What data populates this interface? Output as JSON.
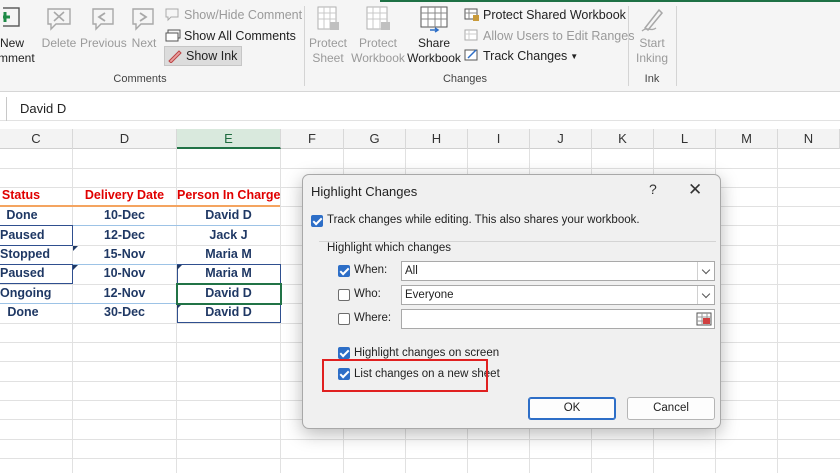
{
  "ribbon": {
    "comments": {
      "new_comment_line1": "New",
      "new_comment_line2": "mment",
      "delete": "Delete",
      "previous": "Previous",
      "next": "Next",
      "show_hide": "Show/Hide Comment",
      "show_all": "Show All Comments",
      "show_ink": "Show Ink",
      "group_label": "Comments"
    },
    "changes": {
      "protect_sheet_1": "Protect",
      "protect_sheet_2": "Sheet",
      "protect_workbook_1": "Protect",
      "protect_workbook_2": "Workbook",
      "share_workbook_1": "Share",
      "share_workbook_2": "Workbook",
      "protect_shared": "Protect Shared Workbook",
      "allow_users": "Allow Users to Edit Ranges",
      "track_changes": "Track Changes",
      "group_label": "Changes"
    },
    "ink": {
      "start_inking_1": "Start",
      "start_inking_2": "Inking",
      "group_label": "Ink"
    }
  },
  "formula_bar": {
    "value": "David D"
  },
  "grid": {
    "columns": [
      "C",
      "D",
      "E",
      "F",
      "G",
      "H",
      "I",
      "J",
      "K",
      "L",
      "M",
      "N"
    ],
    "headers": [
      "Status",
      "Delivery Date",
      "Person In Charge"
    ],
    "rows": [
      [
        "Done",
        "10-Dec",
        "David D"
      ],
      [
        "Paused",
        "12-Dec",
        "Jack J"
      ],
      [
        "Stopped",
        "15-Nov",
        "Maria M"
      ],
      [
        "Paused",
        "10-Nov",
        "Maria M"
      ],
      [
        "Ongoing",
        "12-Nov",
        "David D"
      ],
      [
        "Done",
        "30-Dec",
        "David D"
      ]
    ]
  },
  "dialog": {
    "title": "Highlight Changes",
    "help": "?",
    "close": "✕",
    "track_label": "Track changes while editing. This also shares your workbook.",
    "track_checked": true,
    "section_label": "Highlight which changes",
    "when_label": "When:",
    "when_checked": true,
    "when_value": "All",
    "who_label": "Who:",
    "who_checked": false,
    "who_value": "Everyone",
    "where_label": "Where:",
    "where_checked": false,
    "where_value": "",
    "on_screen_label": "Highlight changes on screen",
    "on_screen_checked": true,
    "new_sheet_label": "List changes on a new sheet",
    "new_sheet_checked": true,
    "ok_label": "OK",
    "cancel_label": "Cancel"
  },
  "colors": {
    "accent": "#217346",
    "header_text": "#e00000",
    "cell_text": "#1f3864",
    "checkbox": "#2d6ec7",
    "highlight_box": "#e02020"
  }
}
